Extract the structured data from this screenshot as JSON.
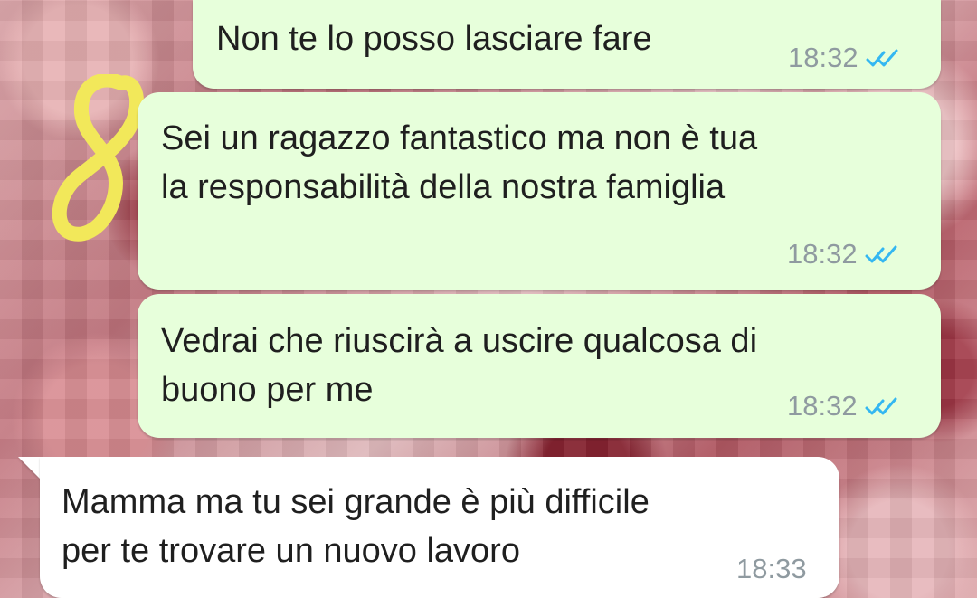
{
  "chat": {
    "messages": [
      {
        "direction": "outgoing",
        "text": "Non te lo posso lasciare fare",
        "time": "18:32",
        "status_icon": "double-check-icon"
      },
      {
        "direction": "outgoing",
        "text": "Sei un ragazzo fantastico ma non è tua\nla responsabilità della nostra famiglia",
        "time": "18:32",
        "status_icon": "double-check-icon"
      },
      {
        "direction": "outgoing",
        "text": "Vedrai che riuscirà a uscire qualcosa di\nbuono per me",
        "time": "18:32",
        "status_icon": "double-check-icon"
      },
      {
        "direction": "incoming",
        "text": "Mamma ma tu sei grande è più difficile\nper te trovare un nuovo lavoro",
        "time": "18:33"
      }
    ]
  },
  "annotation": {
    "text": "8"
  },
  "colors": {
    "outgoing_bubble": "#e7ffdb",
    "incoming_bubble": "#ffffff",
    "tick_blue": "#34b7f1",
    "doodle_yellow": "#f2e85a"
  }
}
